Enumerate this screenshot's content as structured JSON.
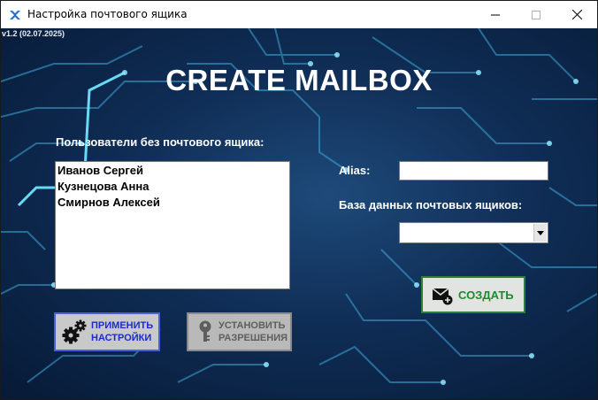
{
  "window": {
    "title": "Настройка почтового ящика",
    "controls": [
      "minimize-icon",
      "maximize-icon",
      "close-icon"
    ]
  },
  "version": "v1.2 (02.07.2025)",
  "headline": "CREATE MAILBOX",
  "users": {
    "label": "Пользователи без почтового ящика:",
    "items": [
      "Иванов Сергей",
      "Кузнецова Анна",
      "Смирнов Алексей"
    ]
  },
  "alias": {
    "label": "Alias:",
    "value": ""
  },
  "database": {
    "label": "База данных почтовых ящиков:",
    "selected": ""
  },
  "buttons": {
    "create": {
      "label": "СОЗДАТЬ",
      "icon": "mail-add-icon"
    },
    "apply": {
      "line1": "ПРИМЕНИТЬ",
      "line2": "НАСТРОЙКИ",
      "icon": "gears-icon"
    },
    "permissions": {
      "line1": "УСТАНОВИТЬ",
      "line2": "РАЗРЕШЕНИЯ",
      "icon": "key-icon"
    }
  },
  "colors": {
    "background": "#0f2d55",
    "circuit": "#3fa8d8",
    "create_text": "#1e8a2e",
    "create_border": "#2f7f3a",
    "apply_text": "#1a2bd0",
    "apply_border": "#4a60d8"
  }
}
